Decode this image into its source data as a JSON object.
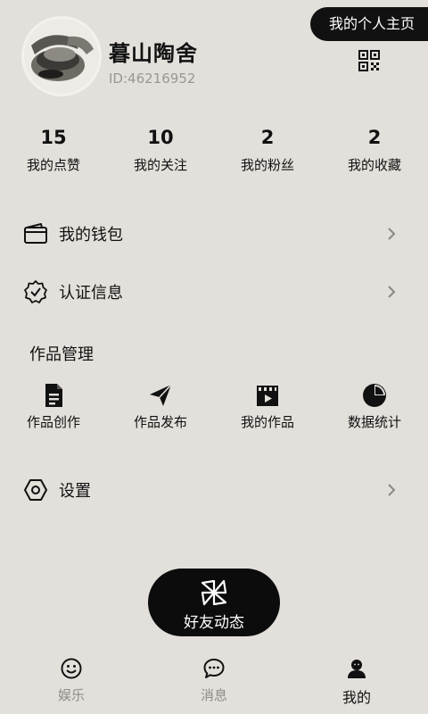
{
  "header": {
    "homepage_button": "我的个人主页",
    "nickname": "暮山陶舍",
    "user_id": "ID:46216952"
  },
  "stats": [
    {
      "value": "15",
      "label": "我的点赞"
    },
    {
      "value": "10",
      "label": "我的关注"
    },
    {
      "value": "2",
      "label": "我的粉丝"
    },
    {
      "value": "2",
      "label": "我的收藏"
    }
  ],
  "menu": {
    "wallet": "我的钱包",
    "verification": "认证信息",
    "settings": "设置"
  },
  "works_section": {
    "title": "作品管理",
    "items": [
      {
        "label": "作品创作",
        "icon": "document-icon"
      },
      {
        "label": "作品发布",
        "icon": "paper-plane-icon"
      },
      {
        "label": "我的作品",
        "icon": "video-clapper-icon"
      },
      {
        "label": "数据统计",
        "icon": "pie-chart-icon"
      }
    ]
  },
  "friends_button": "好友动态",
  "bottom_nav": [
    {
      "label": "娱乐",
      "icon": "smile-icon"
    },
    {
      "label": "消息",
      "icon": "chat-bubble-icon"
    },
    {
      "label": "我的",
      "icon": "user-icon",
      "active": true
    }
  ]
}
